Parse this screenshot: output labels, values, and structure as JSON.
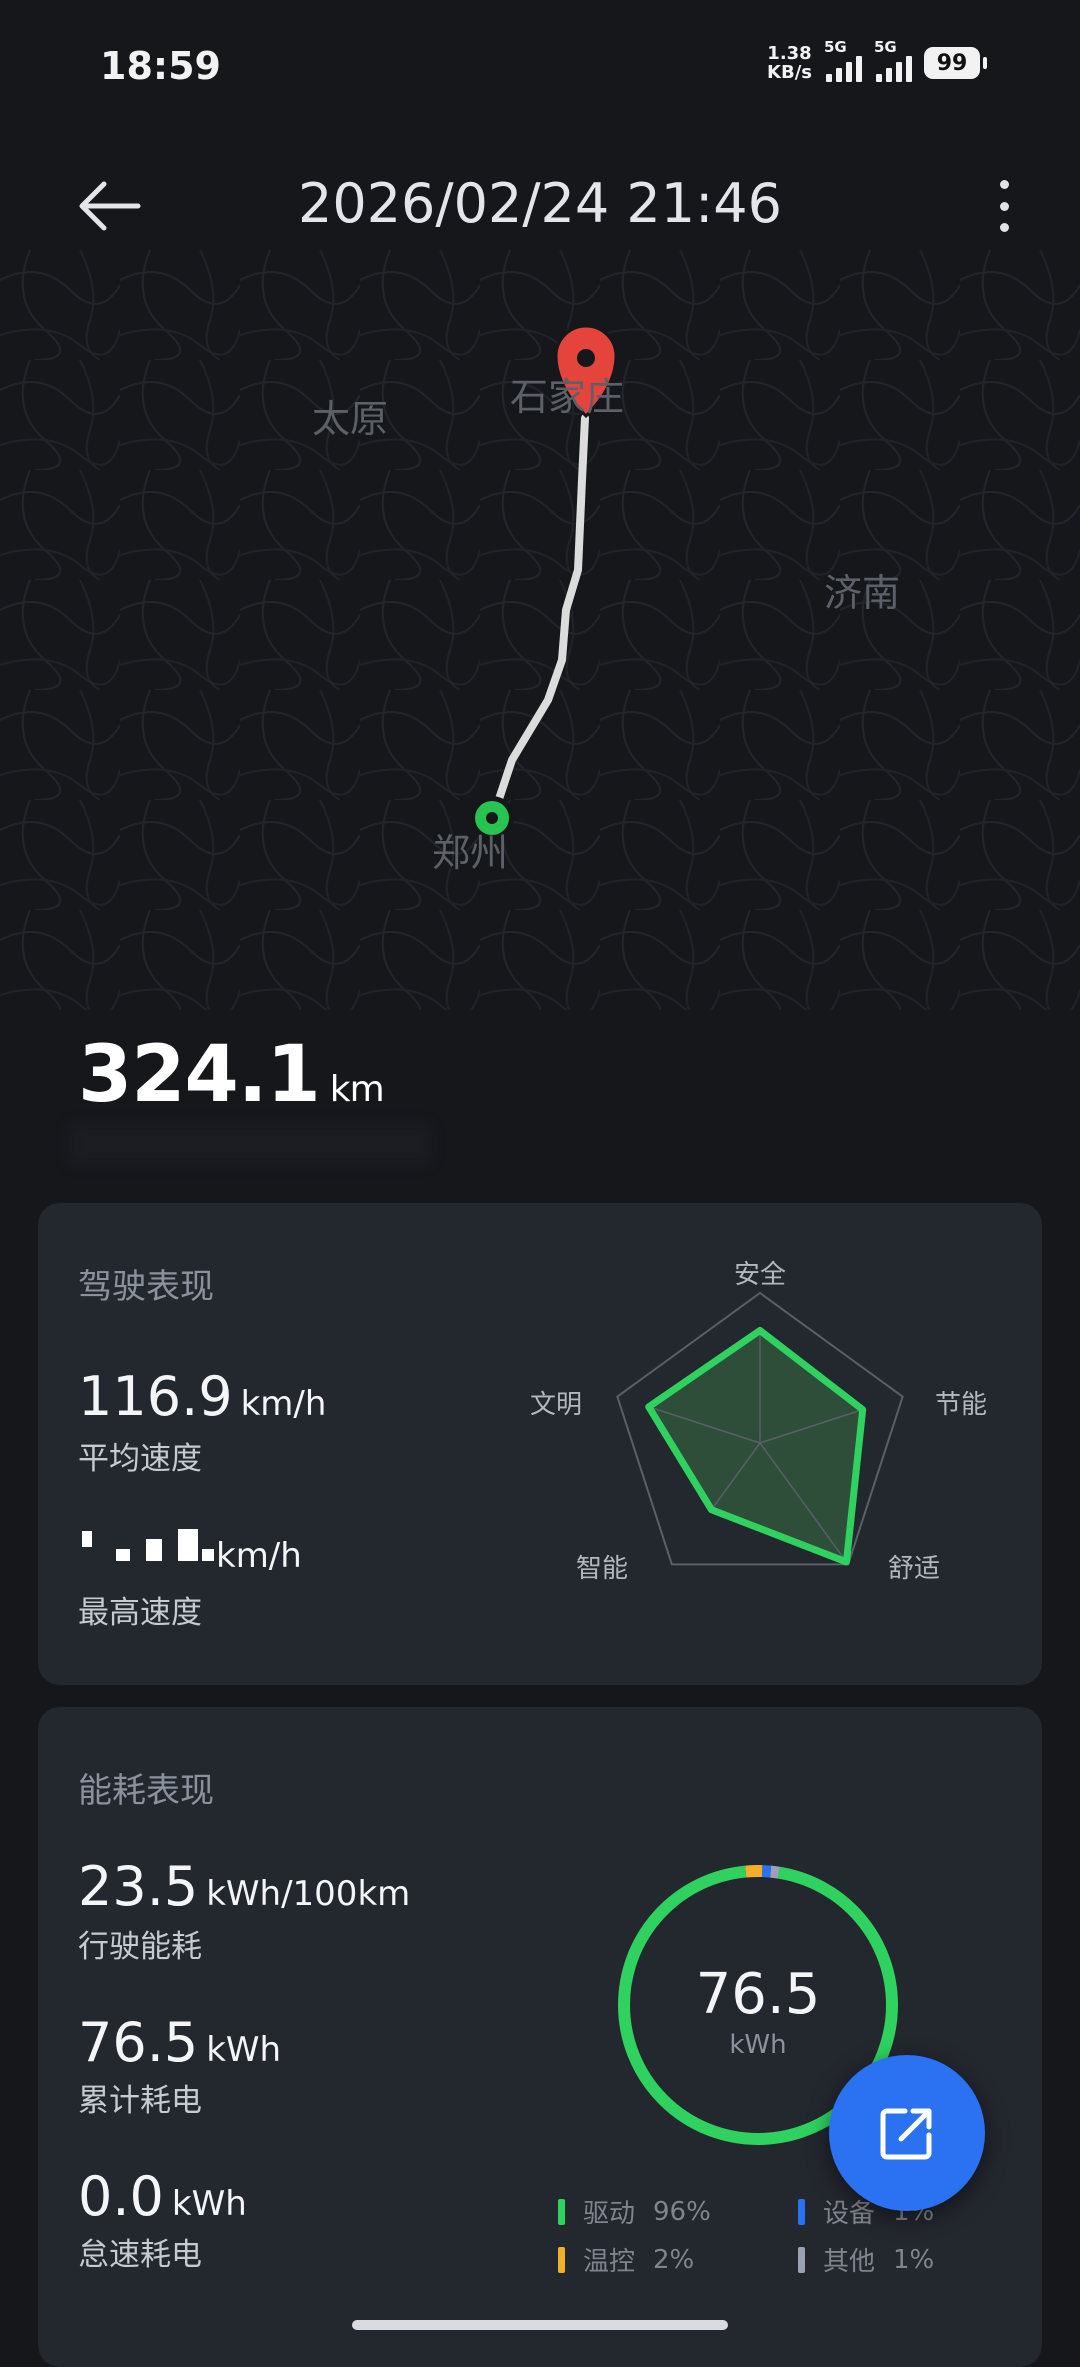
{
  "status_bar": {
    "time": "18:59",
    "net_speed_value": "1.38",
    "net_speed_unit": "KB/s",
    "sim1_label": "5G",
    "sim2_label": "5G",
    "battery": "99"
  },
  "header": {
    "title": "2026/02/24 21:46",
    "back_icon": "arrow-left-icon",
    "more_icon": "more-vertical-icon"
  },
  "map": {
    "cities": [
      "太原",
      "石家庄",
      "济南",
      "郑州"
    ],
    "end_marker_color": "#e5443d",
    "start_marker_color": "#27c452"
  },
  "trip": {
    "distance": "324.1",
    "distance_unit": "km"
  },
  "driving": {
    "title": "驾驶表现",
    "avg_speed_value": "116.9",
    "avg_speed_unit": "km/h",
    "avg_speed_label": "平均速度",
    "max_speed_unit": "km/h",
    "max_speed_label": "最高速度",
    "radar": {
      "labels": [
        "安全",
        "节能",
        "舒适",
        "智能",
        "文明"
      ],
      "values": [
        0.75,
        0.72,
        0.98,
        0.55,
        0.78
      ],
      "color": "#2fd25f"
    }
  },
  "energy": {
    "title": "能耗表现",
    "consumption_value": "23.5",
    "consumption_unit": "kWh/100km",
    "consumption_label": "行驶能耗",
    "total_value": "76.5",
    "total_unit": "kWh",
    "total_label": "累计耗电",
    "idle_value": "0.0",
    "idle_unit": "kWh",
    "idle_label": "怠速耗电",
    "donut_value": "76.5",
    "donut_unit": "kWh",
    "legend": [
      {
        "name": "驱动",
        "pct": "96%",
        "color": "#2fd25f"
      },
      {
        "name": "设备",
        "pct": "1%",
        "color": "#2a72f2"
      },
      {
        "name": "温控",
        "pct": "2%",
        "color": "#f2b02a"
      },
      {
        "name": "其他",
        "pct": "1%",
        "color": "#9aa3b5"
      }
    ]
  },
  "fab": {
    "icon": "share-external-icon"
  }
}
